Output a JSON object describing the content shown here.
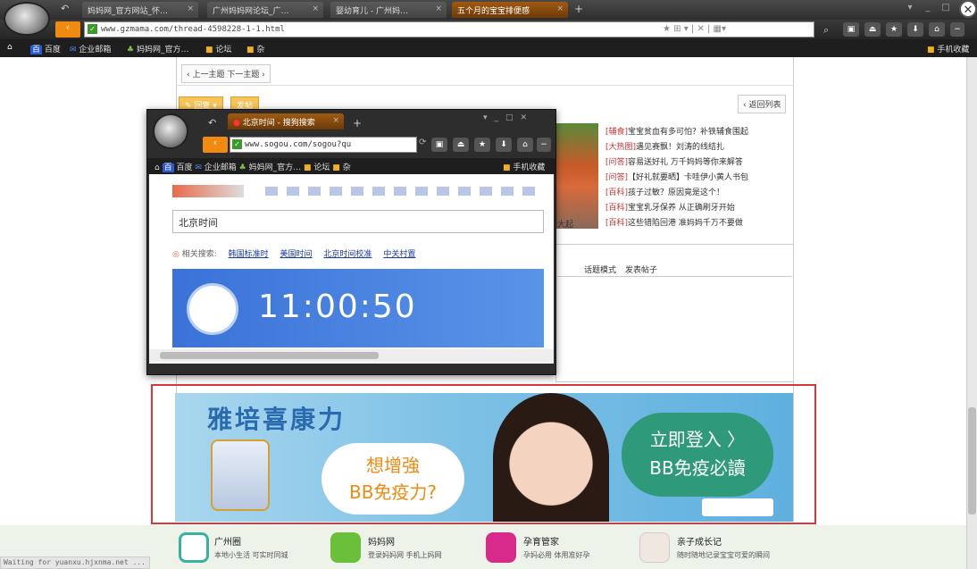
{
  "browser": {
    "tabs": [
      {
        "label": "妈妈网_官方网站_怀…"
      },
      {
        "label": "广州妈妈网论坛_广…"
      },
      {
        "label": "婴幼育儿 - 广州妈…"
      },
      {
        "label": "五个月的宝宝排便感"
      }
    ],
    "url": "www.gzmama.com/thread-4598228-1-1.html",
    "bookmarks": [
      "百度",
      "企业邮箱",
      "妈妈网_官方…",
      "论坛",
      "杂"
    ],
    "mobile_bookmarks": "手机收藏",
    "status": "Waiting for yuanxu.hjxnma.net ..."
  },
  "thread": {
    "nav": "‹ 上一主题  下一主题 ›",
    "reply_label": "回复",
    "post_label": "发帖",
    "back_list": "‹ 返回列表",
    "side_items": [
      {
        "tag": "[辅食]",
        "text": "宝宝贫血有多可怕？补铁辅食围起"
      },
      {
        "tag": "[大热图]",
        "text": "遇见赛飘！刘涛的线结扎"
      },
      {
        "tag": "[问答]",
        "text": "容易送好礼 万千妈妈等你来解答"
      },
      {
        "tag": "[问答]",
        "text": "【好礼就要晒】卡哇伊小黄人书包"
      },
      {
        "tag": "[百科]",
        "text": "孩子过敏？原因竟是这个！"
      },
      {
        "tag": "[百科]",
        "text": "宝宝乳牙保养 从正确刷牙开始"
      },
      {
        "tag": "[百科]",
        "text": "这些错陷回港 准妈妈千万不要做"
      }
    ],
    "table_headers": [
      "话题模式",
      "发表帖子"
    ],
    "avatar_caption": "大起"
  },
  "popup": {
    "tab": "北京时间 - 搜狗搜索",
    "url": "www.sogou.com/sogou?qu",
    "bookmarks": [
      "百度",
      "企业邮箱",
      "妈妈网_官方…",
      "论坛",
      "杂"
    ],
    "mobile_bookmarks": "手机收藏",
    "search_value": "北京时间",
    "related_label": "相关搜索:",
    "related": [
      "韩国标准时",
      "美国时间",
      "北京时间校准",
      "中关村置"
    ],
    "time": "11:00:50"
  },
  "ad": {
    "brand": "雅培喜康力",
    "bubble_left": "想增強\nBB免疫力?",
    "bubble_right": "立即登入 〉\nBB免疫必讀"
  },
  "footer": [
    {
      "title": "广州圈",
      "sub": "本地小生活 可实时同城"
    },
    {
      "title": "妈妈网",
      "sub": "登录妈妈网 手机上妈网"
    },
    {
      "title": "孕育管家",
      "sub": "孕妈必用 体用准好孕"
    },
    {
      "title": "亲子成长记",
      "sub": "随时随地记录宝宝可爱的瞬间"
    }
  ],
  "colors": {
    "accent": "#f08a10",
    "frame": "#d9383a"
  }
}
